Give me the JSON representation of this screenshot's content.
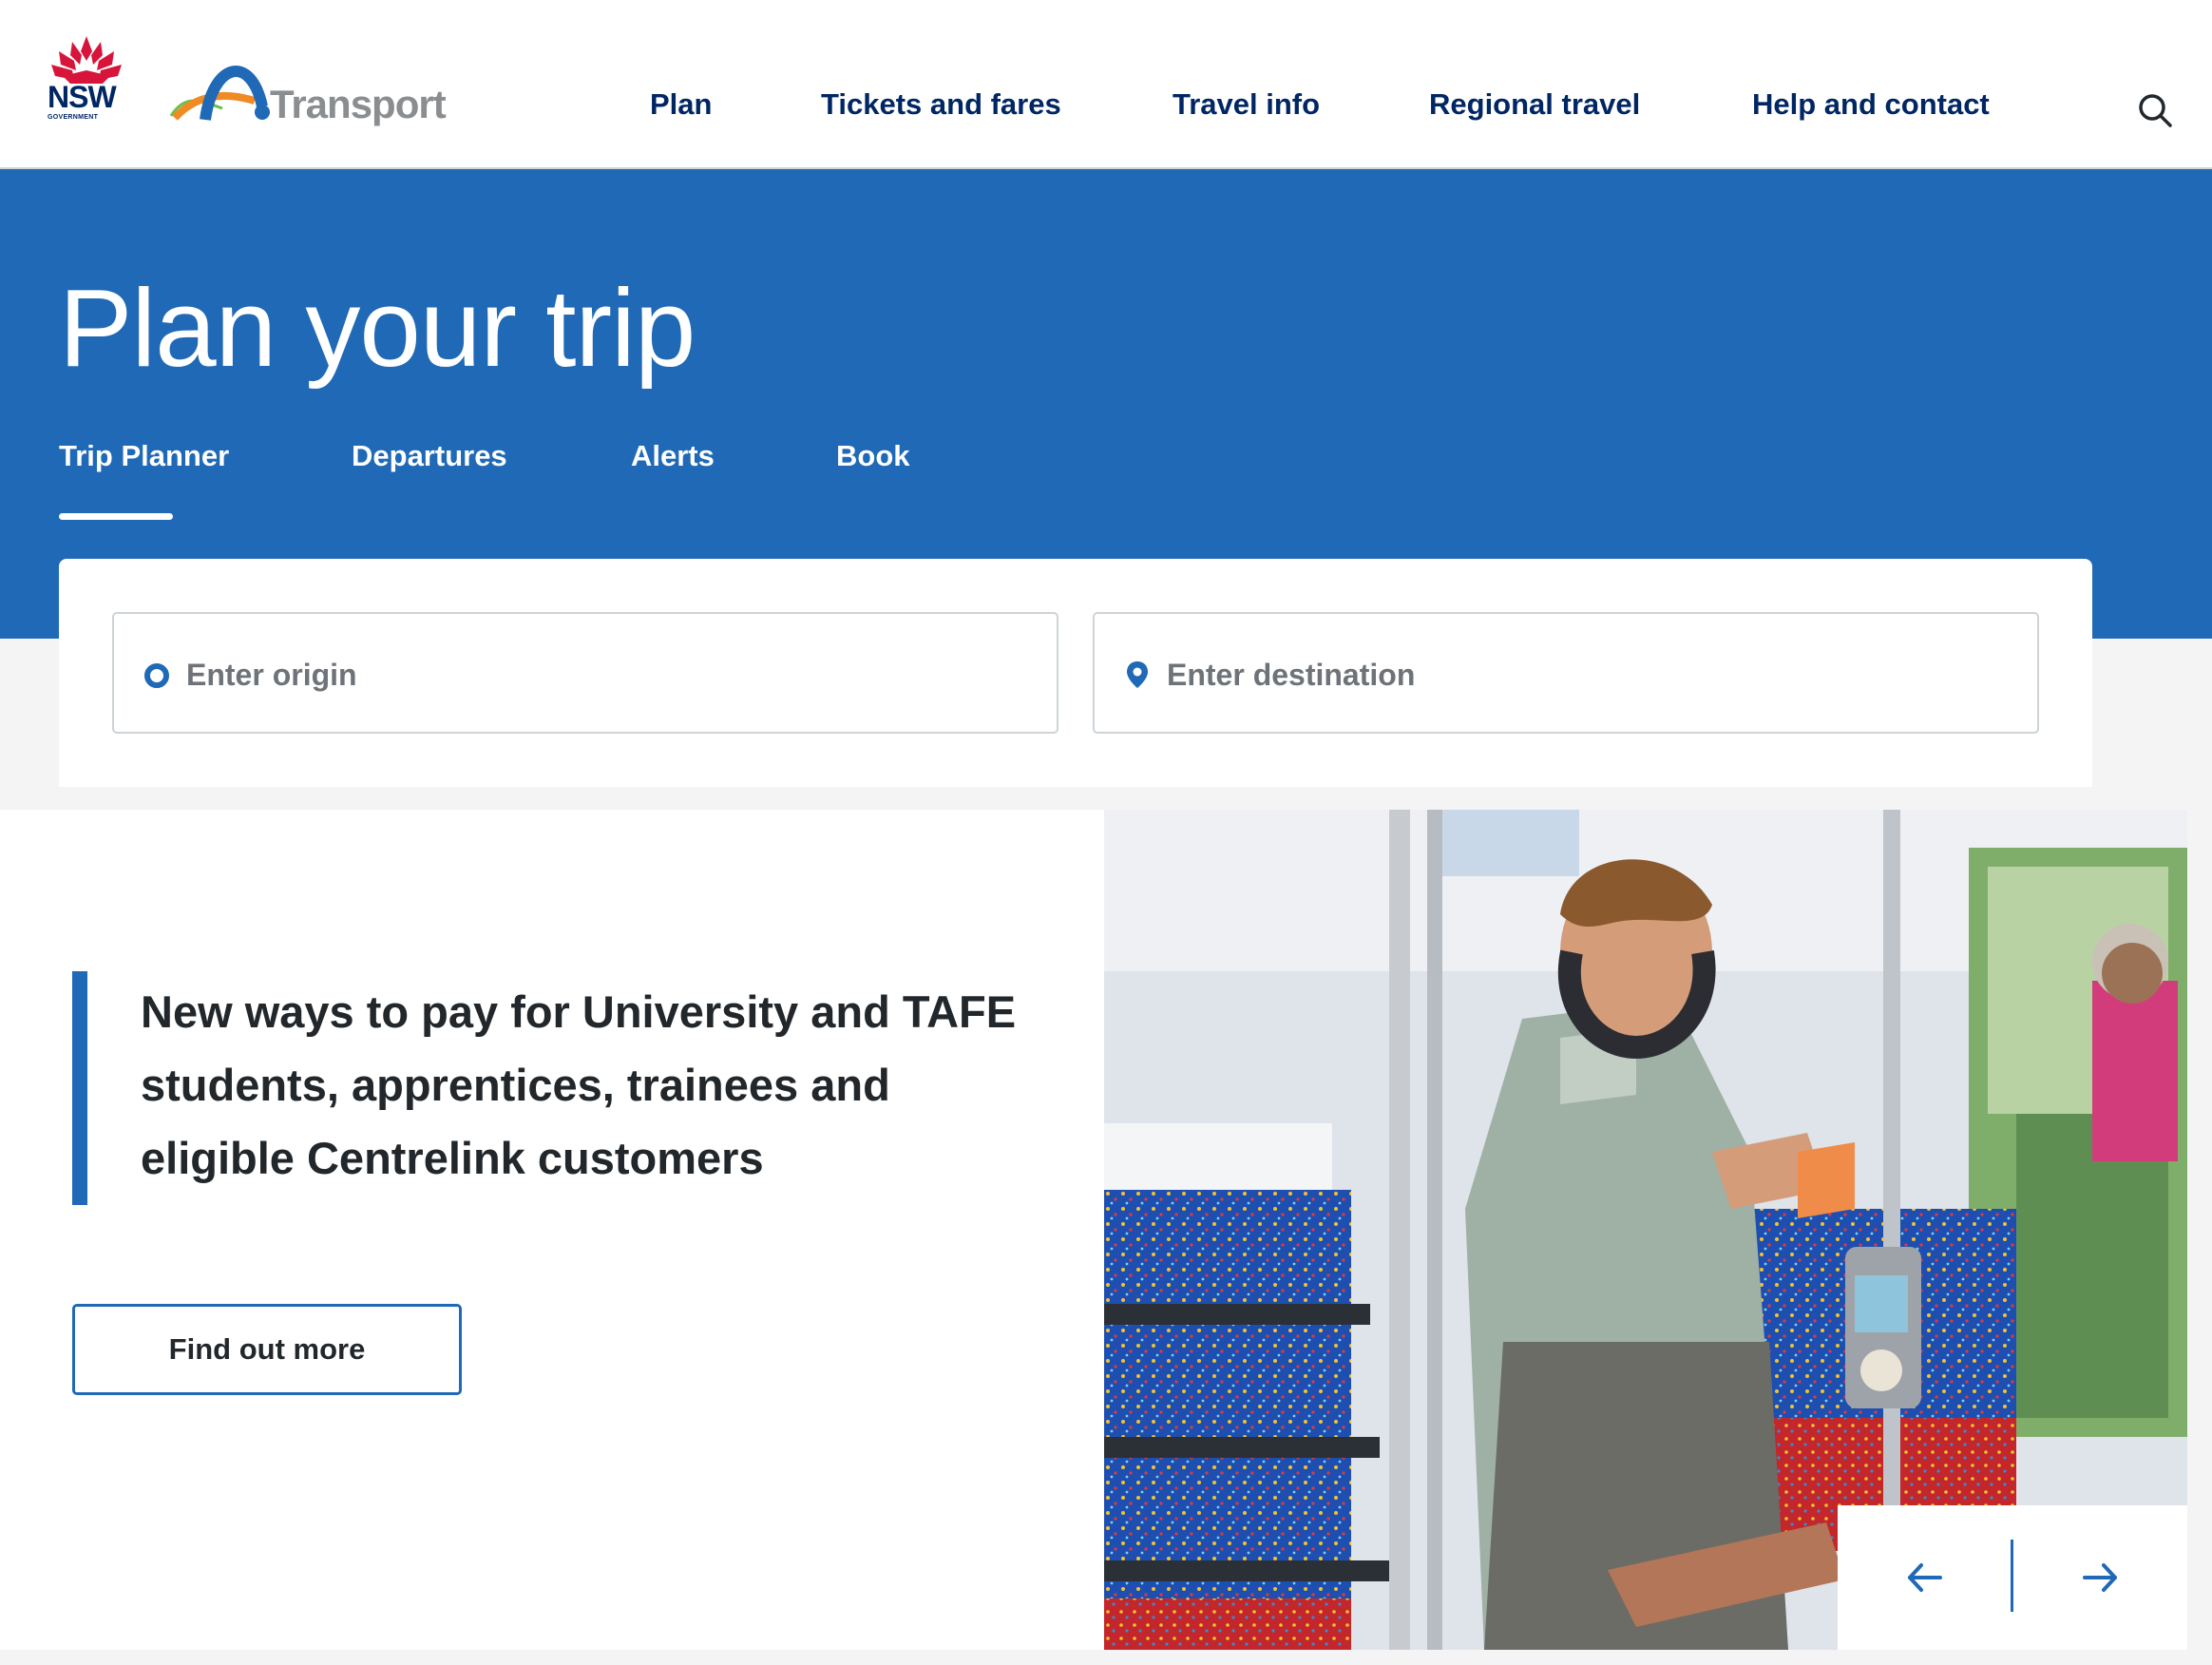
{
  "header": {
    "gov_logo_text": "NSW",
    "gov_logo_sub": "GOVERNMENT",
    "transport_logo_text": "Transport",
    "nav": [
      "Plan",
      "Tickets and fares",
      "Travel info",
      "Regional travel",
      "Help and contact"
    ],
    "search_icon": "search-icon"
  },
  "hero": {
    "title": "Plan your trip",
    "tabs": [
      "Trip Planner",
      "Departures",
      "Alerts",
      "Book"
    ],
    "active_tab": "Trip Planner"
  },
  "trip_planner": {
    "origin_placeholder": "Enter origin",
    "destination_placeholder": "Enter destination"
  },
  "promo": {
    "headline": "New ways to pay for University and TAFE students, apprentices, trainees and eligible Centrelink customers",
    "button_label": "Find out more",
    "image_description_icon": "bus-passenger-photo"
  },
  "carousel": {
    "prev_icon": "arrow-left-icon",
    "next_icon": "arrow-right-icon"
  },
  "colors": {
    "brand_blue": "#1f69b6",
    "navy": "#002664",
    "nsw_red": "#d7153a"
  }
}
